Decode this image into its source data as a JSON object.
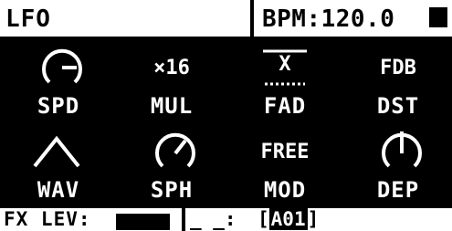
{
  "header": {
    "title": "LFO",
    "bpm": "BPM:120.0"
  },
  "params": {
    "spd": {
      "label": "SPD",
      "icon": "dial-icon"
    },
    "mul": {
      "label": "MUL",
      "value": "×16"
    },
    "fad": {
      "label": "FAD",
      "value": "X"
    },
    "fdb": {
      "label": "DST",
      "value": "FDB"
    },
    "wav": {
      "label": "WAV",
      "icon": "triangle-wave-icon"
    },
    "sph": {
      "label": "SPH",
      "icon": "dial-icon"
    },
    "mod": {
      "label": "MOD",
      "value": "FREE"
    },
    "dep": {
      "label": "DEP",
      "icon": "dial-icon"
    }
  },
  "footer": {
    "fx_label": "FX LEV:",
    "dash": "_ _:",
    "slot_left": "[",
    "slot_value": "A01",
    "slot_right": "]"
  },
  "colors": {
    "background": "#000000",
    "foreground": "#ffffff"
  }
}
